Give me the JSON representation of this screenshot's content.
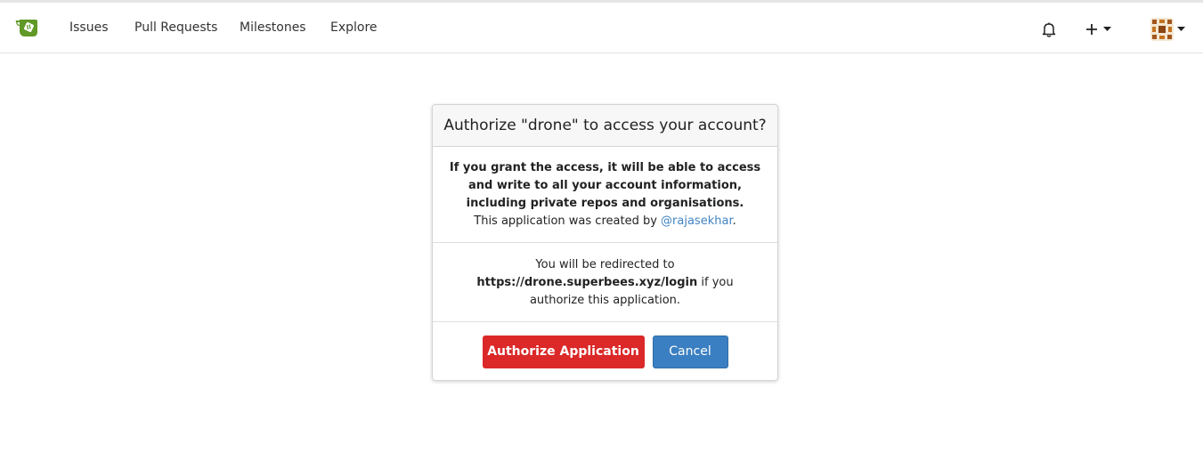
{
  "nav": {
    "items": [
      "Issues",
      "Pull Requests",
      "Milestones",
      "Explore"
    ]
  },
  "icons": {
    "logo": "gitea-teacup-icon",
    "notifications": "bell-icon",
    "create": "plus-icon",
    "dropdown": "caret-down-icon"
  },
  "colors": {
    "brand_green": "#609926",
    "danger": "#db2828",
    "primary": "#3a7fc1",
    "link": "#4183c4"
  },
  "dialog": {
    "title": "Authorize \"drone\" to access your account?",
    "grant_warning": "If you grant the access, it will be able to access and write to all your account information, including private repos and organisations.",
    "created_by_prefix": "This application was created by ",
    "creator": "@rajasekhar",
    "created_by_suffix": ".",
    "redirect_prefix": "You will be redirected to",
    "redirect_url": "https://drone.superbees.xyz/login",
    "redirect_suffix": " if you authorize this application.",
    "authorize_label": "Authorize Application",
    "cancel_label": "Cancel"
  }
}
